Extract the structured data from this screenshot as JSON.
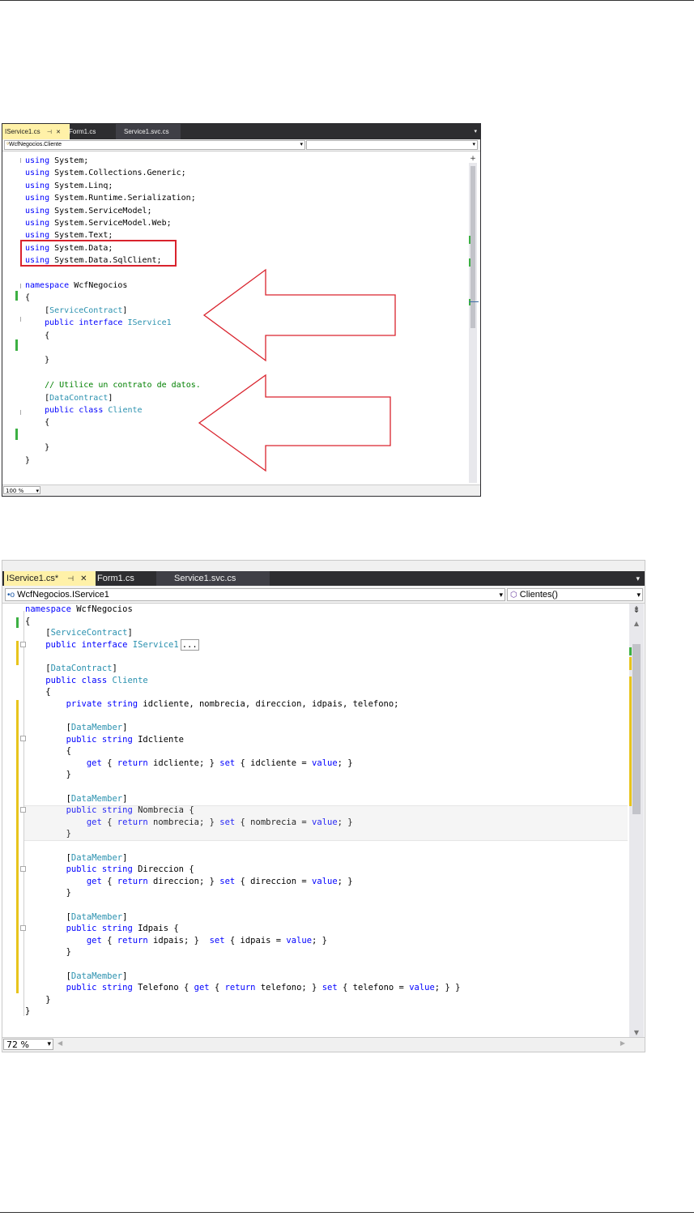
{
  "screenshot1": {
    "tabs": [
      {
        "label": "IService1.cs",
        "pin": "⊣",
        "close": "✕"
      },
      {
        "label": "Form1.cs"
      },
      {
        "label": "Service1.svc.cs"
      }
    ],
    "nav_left": "WcfNegocios.Cliente",
    "zoom": "100 %",
    "lines": [
      [
        {
          "t": "using",
          "c": "kw"
        },
        {
          "t": " System;"
        }
      ],
      [
        {
          "t": "using",
          "c": "kw"
        },
        {
          "t": " System.Collections.Generic;"
        }
      ],
      [
        {
          "t": "using",
          "c": "kw"
        },
        {
          "t": " System.Linq;"
        }
      ],
      [
        {
          "t": "using",
          "c": "kw"
        },
        {
          "t": " System.Runtime.Serialization;"
        }
      ],
      [
        {
          "t": "using",
          "c": "kw"
        },
        {
          "t": " System.ServiceModel;"
        }
      ],
      [
        {
          "t": "using",
          "c": "kw"
        },
        {
          "t": " System.ServiceModel.Web;"
        }
      ],
      [
        {
          "t": "using",
          "c": "kw"
        },
        {
          "t": " System.Text;"
        }
      ],
      [
        {
          "t": "using",
          "c": "kw"
        },
        {
          "t": " System.Data;"
        }
      ],
      [
        {
          "t": "using",
          "c": "kw"
        },
        {
          "t": " System.Data.SqlClient;"
        }
      ],
      [],
      [
        {
          "t": "namespace",
          "c": "kw"
        },
        {
          "t": " WcfNegocios"
        }
      ],
      [
        {
          "t": "{"
        }
      ],
      [
        {
          "t": "    ["
        },
        {
          "t": "ServiceContract",
          "c": "ty"
        },
        {
          "t": "]"
        }
      ],
      [
        {
          "t": "    "
        },
        {
          "t": "public",
          "c": "kw"
        },
        {
          "t": " "
        },
        {
          "t": "interface",
          "c": "kw"
        },
        {
          "t": " "
        },
        {
          "t": "IService1",
          "c": "ty"
        }
      ],
      [
        {
          "t": "    {"
        }
      ],
      [],
      [
        {
          "t": "    }"
        }
      ],
      [],
      [
        {
          "t": "    "
        },
        {
          "t": "// Utilice un contrato de datos.",
          "c": "cm"
        }
      ],
      [
        {
          "t": "    ["
        },
        {
          "t": "DataContract",
          "c": "ty"
        },
        {
          "t": "]"
        }
      ],
      [
        {
          "t": "    "
        },
        {
          "t": "public",
          "c": "kw"
        },
        {
          "t": " "
        },
        {
          "t": "class",
          "c": "kw"
        },
        {
          "t": " "
        },
        {
          "t": "Cliente",
          "c": "ty"
        }
      ],
      [
        {
          "t": "    {"
        }
      ],
      [],
      [
        {
          "t": "    }"
        }
      ],
      [
        {
          "t": "}"
        }
      ]
    ]
  },
  "screenshot2": {
    "tabs": [
      {
        "label": "IService1.cs*",
        "pin": "⊣",
        "close": "✕"
      },
      {
        "label": "Form1.cs"
      },
      {
        "label": "Service1.svc.cs"
      }
    ],
    "nav_left": "WcfNegocios.IService1",
    "nav_right": "Clientes()",
    "zoom": "72 %",
    "lines": [
      [
        {
          "t": "namespace",
          "c": "kw"
        },
        {
          "t": " WcfNegocios"
        }
      ],
      [
        {
          "t": "{"
        }
      ],
      [
        {
          "t": "    ["
        },
        {
          "t": "ServiceContract",
          "c": "ty"
        },
        {
          "t": "]"
        }
      ],
      [
        {
          "t": "    "
        },
        {
          "t": "public",
          "c": "kw"
        },
        {
          "t": " "
        },
        {
          "t": "interface",
          "c": "kw"
        },
        {
          "t": " "
        },
        {
          "t": "IService1",
          "c": "ty"
        },
        {
          "t": "...",
          "c": "box"
        }
      ],
      [],
      [
        {
          "t": "    ["
        },
        {
          "t": "DataContract",
          "c": "ty"
        },
        {
          "t": "]"
        }
      ],
      [
        {
          "t": "    "
        },
        {
          "t": "public",
          "c": "kw"
        },
        {
          "t": " "
        },
        {
          "t": "class",
          "c": "kw"
        },
        {
          "t": " "
        },
        {
          "t": "Cliente",
          "c": "ty"
        }
      ],
      [
        {
          "t": "    {"
        }
      ],
      [
        {
          "t": "        "
        },
        {
          "t": "private",
          "c": "kw"
        },
        {
          "t": " "
        },
        {
          "t": "string",
          "c": "kw"
        },
        {
          "t": " idcliente, nombrecia, direccion, idpais, telefono;"
        }
      ],
      [],
      [
        {
          "t": "        ["
        },
        {
          "t": "DataMember",
          "c": "ty"
        },
        {
          "t": "]"
        }
      ],
      [
        {
          "t": "        "
        },
        {
          "t": "public",
          "c": "kw"
        },
        {
          "t": " "
        },
        {
          "t": "string",
          "c": "kw"
        },
        {
          "t": " Idcliente"
        }
      ],
      [
        {
          "t": "        {"
        }
      ],
      [
        {
          "t": "            "
        },
        {
          "t": "get",
          "c": "kw"
        },
        {
          "t": " { "
        },
        {
          "t": "return",
          "c": "kw"
        },
        {
          "t": " idcliente; } "
        },
        {
          "t": "set",
          "c": "kw"
        },
        {
          "t": " { idcliente = "
        },
        {
          "t": "value",
          "c": "kw"
        },
        {
          "t": "; }"
        }
      ],
      [
        {
          "t": "        }"
        }
      ],
      [],
      [
        {
          "t": "        ["
        },
        {
          "t": "DataMember",
          "c": "ty"
        },
        {
          "t": "]"
        }
      ],
      [
        {
          "t": "        "
        },
        {
          "t": "public",
          "c": "kw"
        },
        {
          "t": " "
        },
        {
          "t": "string",
          "c": "kw"
        },
        {
          "t": " Nombrecia {"
        }
      ],
      [
        {
          "t": "            "
        },
        {
          "t": "get",
          "c": "kw"
        },
        {
          "t": " { "
        },
        {
          "t": "return",
          "c": "kw"
        },
        {
          "t": " nombrecia; } "
        },
        {
          "t": "set",
          "c": "kw"
        },
        {
          "t": " { nombrecia = "
        },
        {
          "t": "value",
          "c": "kw"
        },
        {
          "t": "; }"
        }
      ],
      [
        {
          "t": "        }"
        }
      ],
      [],
      [
        {
          "t": "        ["
        },
        {
          "t": "DataMember",
          "c": "ty"
        },
        {
          "t": "]"
        }
      ],
      [
        {
          "t": "        "
        },
        {
          "t": "public",
          "c": "kw"
        },
        {
          "t": " "
        },
        {
          "t": "string",
          "c": "kw"
        },
        {
          "t": " Direccion {"
        }
      ],
      [
        {
          "t": "            "
        },
        {
          "t": "get",
          "c": "kw"
        },
        {
          "t": " { "
        },
        {
          "t": "return",
          "c": "kw"
        },
        {
          "t": " direccion; } "
        },
        {
          "t": "set",
          "c": "kw"
        },
        {
          "t": " { direccion = "
        },
        {
          "t": "value",
          "c": "kw"
        },
        {
          "t": "; }"
        }
      ],
      [
        {
          "t": "        }"
        }
      ],
      [],
      [
        {
          "t": "        ["
        },
        {
          "t": "DataMember",
          "c": "ty"
        },
        {
          "t": "]"
        }
      ],
      [
        {
          "t": "        "
        },
        {
          "t": "public",
          "c": "kw"
        },
        {
          "t": " "
        },
        {
          "t": "string",
          "c": "kw"
        },
        {
          "t": " Idpais {"
        }
      ],
      [
        {
          "t": "            "
        },
        {
          "t": "get",
          "c": "kw"
        },
        {
          "t": " { "
        },
        {
          "t": "return",
          "c": "kw"
        },
        {
          "t": " idpais; }  "
        },
        {
          "t": "set",
          "c": "kw"
        },
        {
          "t": " { idpais = "
        },
        {
          "t": "value",
          "c": "kw"
        },
        {
          "t": "; }"
        }
      ],
      [
        {
          "t": "        }"
        }
      ],
      [],
      [
        {
          "t": "        ["
        },
        {
          "t": "DataMember",
          "c": "ty"
        },
        {
          "t": "]"
        }
      ],
      [
        {
          "t": "        "
        },
        {
          "t": "public",
          "c": "kw"
        },
        {
          "t": " "
        },
        {
          "t": "string",
          "c": "kw"
        },
        {
          "t": " Telefono { "
        },
        {
          "t": "get",
          "c": "kw"
        },
        {
          "t": " { "
        },
        {
          "t": "return",
          "c": "kw"
        },
        {
          "t": " telefono; } "
        },
        {
          "t": "set",
          "c": "kw"
        },
        {
          "t": " { telefono = "
        },
        {
          "t": "value",
          "c": "kw"
        },
        {
          "t": "; } }"
        }
      ],
      [
        {
          "t": "    }"
        }
      ],
      [
        {
          "t": "}"
        }
      ]
    ]
  },
  "colors": {
    "keyword": "#0000ff",
    "type": "#2b91af",
    "comment": "#008000",
    "highlight_box": "#d9232d",
    "arrow": "#d9232d",
    "active_tab": "#fff1a8",
    "tabbar": "#2d2d30"
  }
}
